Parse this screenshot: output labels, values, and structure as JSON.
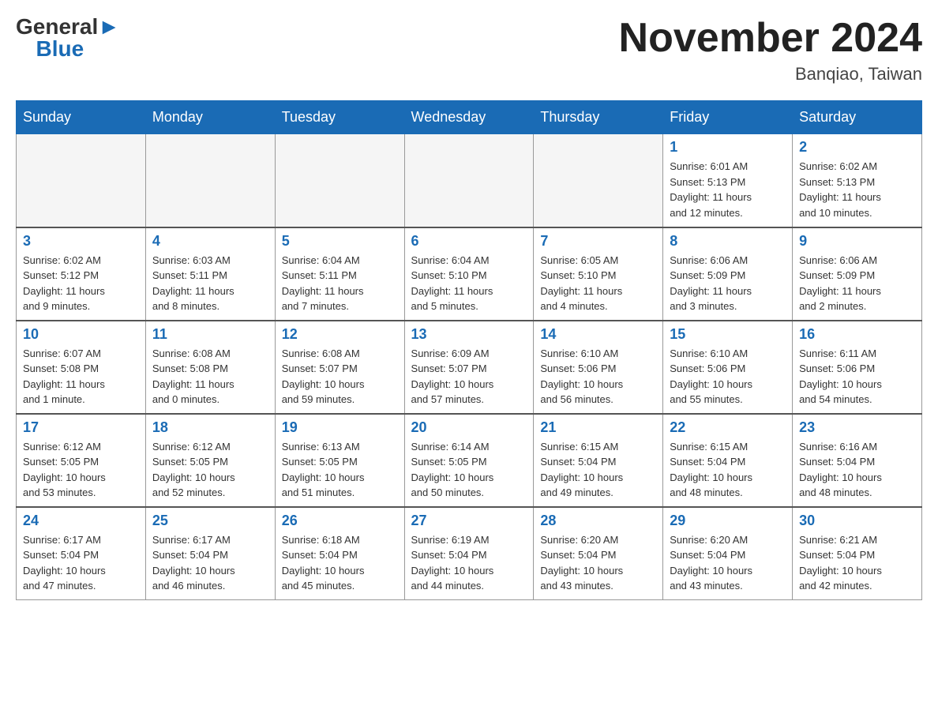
{
  "header": {
    "logo_general": "General",
    "logo_blue": "Blue",
    "month_title": "November 2024",
    "location": "Banqiao, Taiwan"
  },
  "calendar": {
    "days_of_week": [
      "Sunday",
      "Monday",
      "Tuesday",
      "Wednesday",
      "Thursday",
      "Friday",
      "Saturday"
    ],
    "weeks": [
      [
        {
          "day": "",
          "info": ""
        },
        {
          "day": "",
          "info": ""
        },
        {
          "day": "",
          "info": ""
        },
        {
          "day": "",
          "info": ""
        },
        {
          "day": "",
          "info": ""
        },
        {
          "day": "1",
          "info": "Sunrise: 6:01 AM\nSunset: 5:13 PM\nDaylight: 11 hours\nand 12 minutes."
        },
        {
          "day": "2",
          "info": "Sunrise: 6:02 AM\nSunset: 5:13 PM\nDaylight: 11 hours\nand 10 minutes."
        }
      ],
      [
        {
          "day": "3",
          "info": "Sunrise: 6:02 AM\nSunset: 5:12 PM\nDaylight: 11 hours\nand 9 minutes."
        },
        {
          "day": "4",
          "info": "Sunrise: 6:03 AM\nSunset: 5:11 PM\nDaylight: 11 hours\nand 8 minutes."
        },
        {
          "day": "5",
          "info": "Sunrise: 6:04 AM\nSunset: 5:11 PM\nDaylight: 11 hours\nand 7 minutes."
        },
        {
          "day": "6",
          "info": "Sunrise: 6:04 AM\nSunset: 5:10 PM\nDaylight: 11 hours\nand 5 minutes."
        },
        {
          "day": "7",
          "info": "Sunrise: 6:05 AM\nSunset: 5:10 PM\nDaylight: 11 hours\nand 4 minutes."
        },
        {
          "day": "8",
          "info": "Sunrise: 6:06 AM\nSunset: 5:09 PM\nDaylight: 11 hours\nand 3 minutes."
        },
        {
          "day": "9",
          "info": "Sunrise: 6:06 AM\nSunset: 5:09 PM\nDaylight: 11 hours\nand 2 minutes."
        }
      ],
      [
        {
          "day": "10",
          "info": "Sunrise: 6:07 AM\nSunset: 5:08 PM\nDaylight: 11 hours\nand 1 minute."
        },
        {
          "day": "11",
          "info": "Sunrise: 6:08 AM\nSunset: 5:08 PM\nDaylight: 11 hours\nand 0 minutes."
        },
        {
          "day": "12",
          "info": "Sunrise: 6:08 AM\nSunset: 5:07 PM\nDaylight: 10 hours\nand 59 minutes."
        },
        {
          "day": "13",
          "info": "Sunrise: 6:09 AM\nSunset: 5:07 PM\nDaylight: 10 hours\nand 57 minutes."
        },
        {
          "day": "14",
          "info": "Sunrise: 6:10 AM\nSunset: 5:06 PM\nDaylight: 10 hours\nand 56 minutes."
        },
        {
          "day": "15",
          "info": "Sunrise: 6:10 AM\nSunset: 5:06 PM\nDaylight: 10 hours\nand 55 minutes."
        },
        {
          "day": "16",
          "info": "Sunrise: 6:11 AM\nSunset: 5:06 PM\nDaylight: 10 hours\nand 54 minutes."
        }
      ],
      [
        {
          "day": "17",
          "info": "Sunrise: 6:12 AM\nSunset: 5:05 PM\nDaylight: 10 hours\nand 53 minutes."
        },
        {
          "day": "18",
          "info": "Sunrise: 6:12 AM\nSunset: 5:05 PM\nDaylight: 10 hours\nand 52 minutes."
        },
        {
          "day": "19",
          "info": "Sunrise: 6:13 AM\nSunset: 5:05 PM\nDaylight: 10 hours\nand 51 minutes."
        },
        {
          "day": "20",
          "info": "Sunrise: 6:14 AM\nSunset: 5:05 PM\nDaylight: 10 hours\nand 50 minutes."
        },
        {
          "day": "21",
          "info": "Sunrise: 6:15 AM\nSunset: 5:04 PM\nDaylight: 10 hours\nand 49 minutes."
        },
        {
          "day": "22",
          "info": "Sunrise: 6:15 AM\nSunset: 5:04 PM\nDaylight: 10 hours\nand 48 minutes."
        },
        {
          "day": "23",
          "info": "Sunrise: 6:16 AM\nSunset: 5:04 PM\nDaylight: 10 hours\nand 48 minutes."
        }
      ],
      [
        {
          "day": "24",
          "info": "Sunrise: 6:17 AM\nSunset: 5:04 PM\nDaylight: 10 hours\nand 47 minutes."
        },
        {
          "day": "25",
          "info": "Sunrise: 6:17 AM\nSunset: 5:04 PM\nDaylight: 10 hours\nand 46 minutes."
        },
        {
          "day": "26",
          "info": "Sunrise: 6:18 AM\nSunset: 5:04 PM\nDaylight: 10 hours\nand 45 minutes."
        },
        {
          "day": "27",
          "info": "Sunrise: 6:19 AM\nSunset: 5:04 PM\nDaylight: 10 hours\nand 44 minutes."
        },
        {
          "day": "28",
          "info": "Sunrise: 6:20 AM\nSunset: 5:04 PM\nDaylight: 10 hours\nand 43 minutes."
        },
        {
          "day": "29",
          "info": "Sunrise: 6:20 AM\nSunset: 5:04 PM\nDaylight: 10 hours\nand 43 minutes."
        },
        {
          "day": "30",
          "info": "Sunrise: 6:21 AM\nSunset: 5:04 PM\nDaylight: 10 hours\nand 42 minutes."
        }
      ]
    ]
  }
}
